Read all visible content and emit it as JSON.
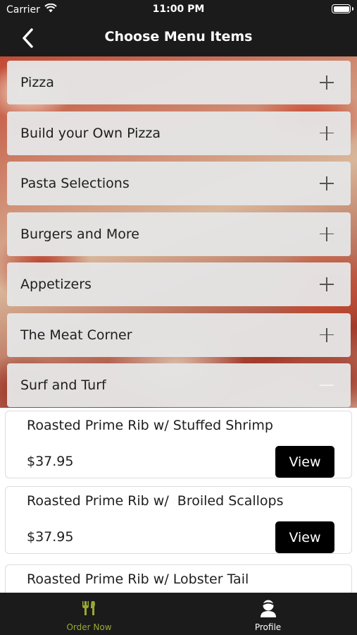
{
  "status_bar": {
    "carrier": "Carrier",
    "time": "11:00 PM"
  },
  "nav": {
    "title": "Choose Menu Items"
  },
  "categories": [
    {
      "label": "Pizza",
      "state": "collapsed"
    },
    {
      "label": "Build your Own Pizza",
      "state": "collapsed"
    },
    {
      "label": "Pasta Selections",
      "state": "collapsed"
    },
    {
      "label": "Burgers and More",
      "state": "collapsed"
    },
    {
      "label": "Appetizers",
      "state": "collapsed"
    },
    {
      "label": "The Meat Corner",
      "state": "collapsed"
    },
    {
      "label": "Surf and Turf",
      "state": "expanded"
    }
  ],
  "items": [
    {
      "name": "Roasted Prime Rib w/ Stuffed Shrimp",
      "price": "$37.95",
      "button": "View"
    },
    {
      "name": "Roasted Prime Rib w/  Broiled Scallops",
      "price": "$37.95",
      "button": "View"
    },
    {
      "name": "Roasted Prime Rib w/ Lobster Tail",
      "price": "",
      "button": ""
    }
  ],
  "tab_bar": {
    "tabs": [
      {
        "label": "Order Now",
        "icon": "cutlery-icon",
        "active": true,
        "color": "#9aa832"
      },
      {
        "label": "Profile",
        "icon": "profile-icon",
        "active": false,
        "color": "#ffffff"
      }
    ]
  },
  "colors": {
    "bar_background": "#1b1b1b",
    "active_tab": "#9aa832",
    "row_background": "#e4e4e4"
  }
}
